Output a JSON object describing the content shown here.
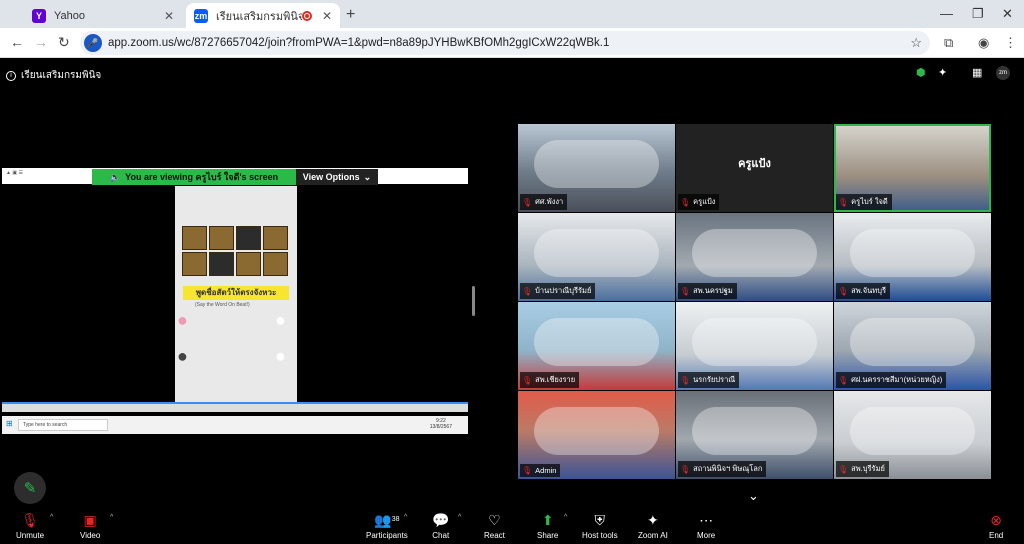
{
  "browser": {
    "tabs": [
      {
        "title": "Yahoo",
        "favicon": "Y",
        "color": "#6001d2"
      },
      {
        "title": "เรียนเสริมกรมพินิจ",
        "favicon": "zm",
        "color": "#0b5cff"
      }
    ],
    "url": "app.zoom.us/wc/87276657042/join?fromPWA=1&pwd=n8a89pJYHBwKBfOMh2ggICxW22qWBk.1"
  },
  "meeting": {
    "title": "เรียนเสริมกรมพินิจ",
    "banner_text": "You are viewing ครูไบร์ ใจดี's screen",
    "view_options": "View Options"
  },
  "shared_screen": {
    "game_title": "พูดชื่อสัตว์ให้ตรงจังหวะ",
    "game_subtitle": "(Say the Word On Beat!)",
    "search_placeholder": "Type here to search",
    "clock_time": "9:22",
    "clock_date": "13/8/2567"
  },
  "participants": [
    {
      "name": "ศศ.พังงา",
      "muted": true
    },
    {
      "name": "ครูแป้ง",
      "muted": true,
      "name_card": "ครูแป้ง"
    },
    {
      "name": "ครูไบร์ ใจดี",
      "muted": true,
      "speaking": true
    },
    {
      "name": "บ้านปราณีบุรีรัมย์",
      "muted": true
    },
    {
      "name": "สพ.นครปฐม",
      "muted": true
    },
    {
      "name": "สพ.จันทบุรี",
      "muted": true
    },
    {
      "name": "สพ.เชียงราย",
      "muted": true
    },
    {
      "name": "นรกรัยปราณี",
      "muted": true
    },
    {
      "name": "ศฝ.นครราชสีมา(หน่วยหญิง)",
      "muted": true
    },
    {
      "name": "Admin",
      "muted": true
    },
    {
      "name": "สถานพินิจฯ พิษณุโลก",
      "muted": true
    },
    {
      "name": "สพ.บุรีรัมย์",
      "muted": true
    }
  ],
  "toolbar": {
    "unmute": "Unmute",
    "video": "Video",
    "participants": "Participants",
    "participant_count": "38",
    "chat": "Chat",
    "react": "React",
    "share": "Share",
    "host_tools": "Host tools",
    "zoom_ai": "Zoom AI",
    "more": "More",
    "end": "End"
  }
}
